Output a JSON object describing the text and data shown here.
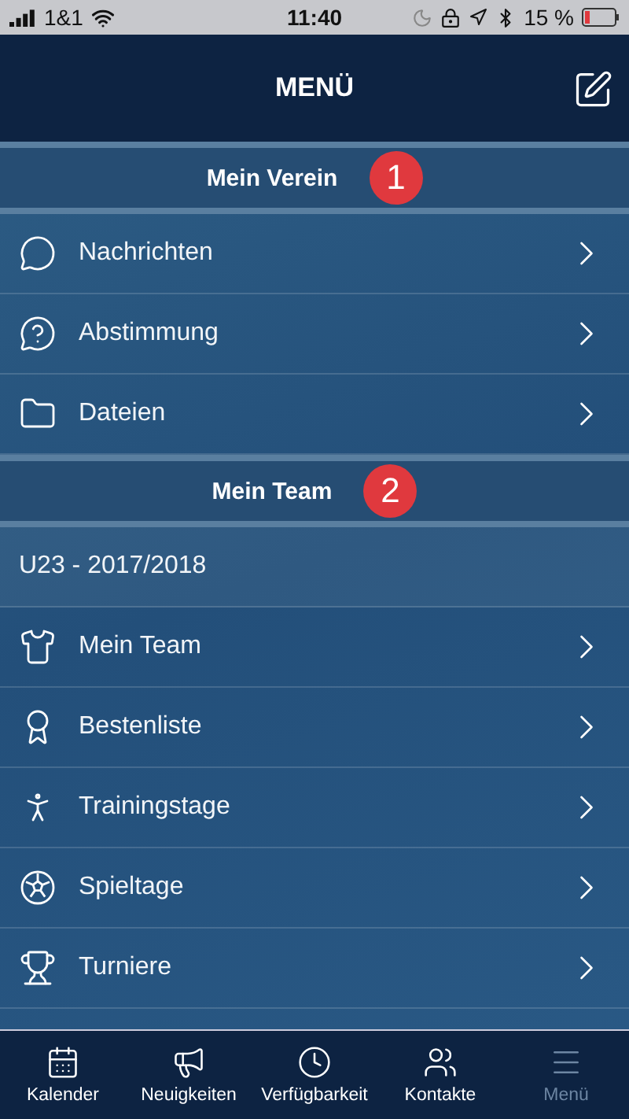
{
  "status_bar": {
    "carrier": "1&1",
    "time": "11:40",
    "battery": "15 %"
  },
  "header": {
    "title": "MENÜ"
  },
  "sections": [
    {
      "title": "Mein Verein",
      "badge": "1",
      "items": [
        {
          "kind": "link",
          "label": "Nachrichten"
        },
        {
          "kind": "link",
          "label": "Abstimmung"
        },
        {
          "kind": "link",
          "label": "Dateien"
        }
      ]
    },
    {
      "title": "Mein Team",
      "badge": "2",
      "items": [
        {
          "kind": "label",
          "label": "U23 - 2017/2018"
        },
        {
          "kind": "link",
          "label": "Mein Team"
        },
        {
          "kind": "link",
          "label": "Bestenliste"
        },
        {
          "kind": "link",
          "label": "Trainingstage"
        },
        {
          "kind": "link",
          "label": "Spieltage"
        },
        {
          "kind": "link",
          "label": "Turniere"
        }
      ]
    }
  ],
  "tabs": [
    {
      "label": "Kalender",
      "selected": false
    },
    {
      "label": "Neuigkeiten",
      "selected": false
    },
    {
      "label": "Verfügbarkeit",
      "selected": false
    },
    {
      "label": "Kontakte",
      "selected": false
    },
    {
      "label": "Menü",
      "selected": true
    }
  ]
}
